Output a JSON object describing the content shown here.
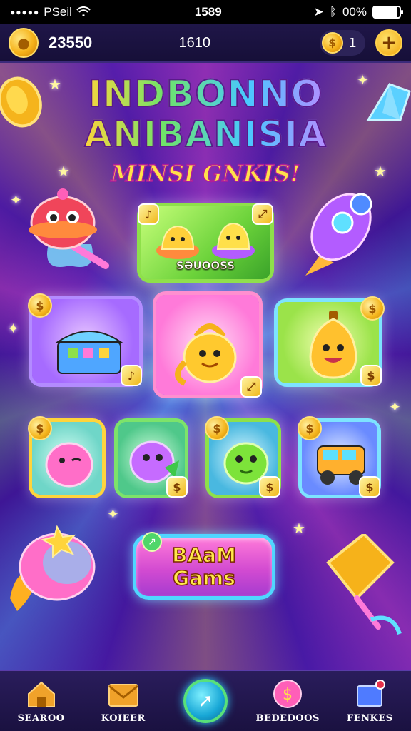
{
  "status_bar": {
    "carrier": "PSeil",
    "time": "1589",
    "battery": "00%",
    "battery_level": 0.9
  },
  "top_bar": {
    "coin_count": "23550",
    "middle_count": "1610",
    "gem_count": "1",
    "add_symbol": "+"
  },
  "title": {
    "line1": "INDBONNO",
    "line2": "ANIBANISIA",
    "subtitle": "MINSI GNKIS!"
  },
  "tiles": {
    "featured_label": "SƏUOOSS",
    "coin_symbol": "$"
  },
  "play_button": {
    "line1": "BAaM",
    "line2": "Gams"
  },
  "bottom_nav": {
    "items": [
      {
        "label": "SEAROO",
        "icon": "home-icon"
      },
      {
        "label": "KOIEER",
        "icon": "envelope-icon"
      },
      {
        "label": "",
        "icon": "play-icon"
      },
      {
        "label": "BEDEDOOS",
        "icon": "bonus-icon"
      },
      {
        "label": "FENKES",
        "icon": "inbox-icon"
      }
    ]
  },
  "colors": {
    "background": "#3a1590",
    "accent_gold": "#f6b21a",
    "accent_cyan": "#4fd6ff",
    "accent_pink": "#ff7ad9"
  }
}
